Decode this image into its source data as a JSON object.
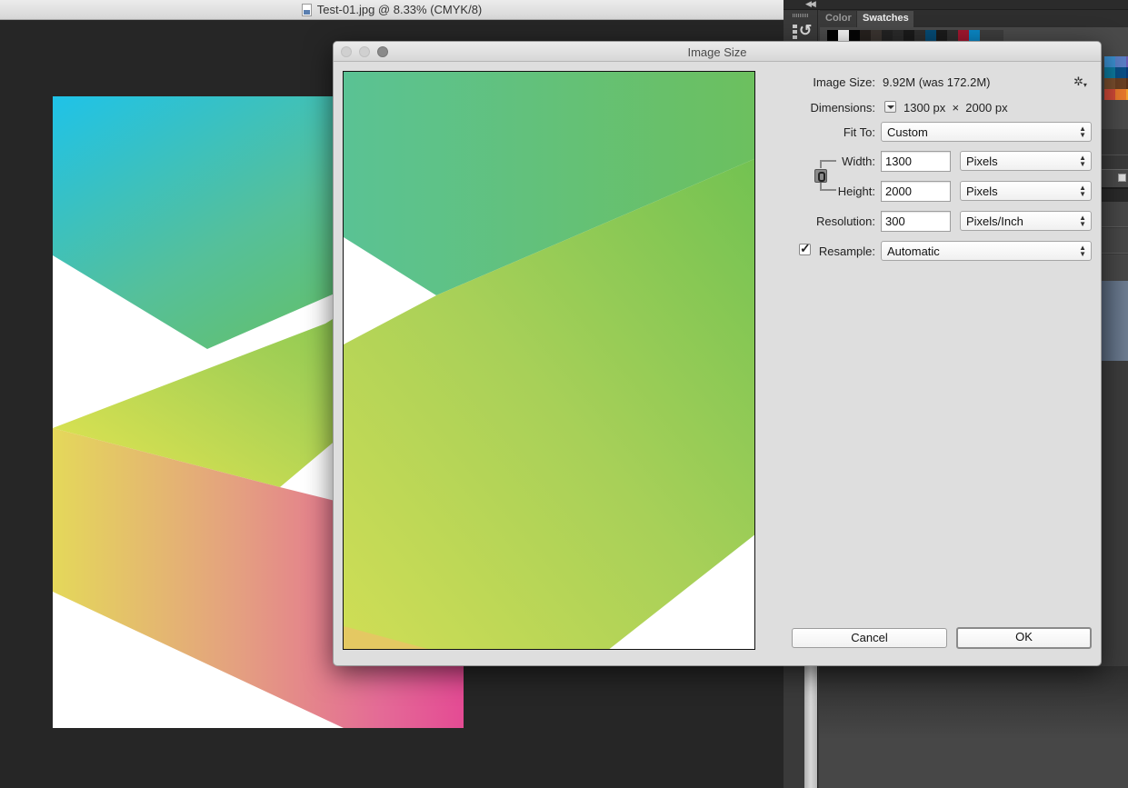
{
  "document": {
    "title": "Test-01.jpg @ 8.33% (CMYK/8)",
    "icon": "jpg-file-icon"
  },
  "panels": {
    "tabs": [
      {
        "label": "Color",
        "active": false
      },
      {
        "label": "Swatches",
        "active": true
      }
    ],
    "swatches_row": [
      "#000000",
      "#f4f4f4",
      "#050505",
      "#26211e",
      "#3a3430",
      "#222222",
      "#2a2a2a",
      "#1a1a1a",
      "#2e2e2e",
      "#054a73",
      "#1b1b1b",
      "#2f2f2f",
      "#a0162f",
      "#0a86c4"
    ],
    "swatches_grid": [
      [
        "#3a8fd0",
        "#5a7ec5",
        "#6a5bb0"
      ],
      [
        "#0d7a9e",
        "#0a4f86",
        "#0a3a78"
      ],
      [
        "#7a4e2e",
        "#6a3f22",
        "#5a3018"
      ],
      [
        "#d24a38",
        "#e8782c",
        "#f0a030"
      ]
    ]
  },
  "dialog": {
    "title": "Image Size",
    "window_controls": [
      "close",
      "minimize",
      "zoom"
    ],
    "image_size_label": "Image Size:",
    "image_size_value": "9.92M (was 172.2M)",
    "settings_icon": "gear-icon",
    "dimensions_label": "Dimensions:",
    "dimensions_value": "1300 px  ×  2000 px",
    "fit_to_label": "Fit To:",
    "fit_to_value": "Custom",
    "width_label": "Width:",
    "width_value": "1300",
    "width_unit": "Pixels",
    "height_label": "Height:",
    "height_value": "2000",
    "height_unit": "Pixels",
    "constrain_proportions": true,
    "resolution_label": "Resolution:",
    "resolution_value": "300",
    "resolution_unit": "Pixels/Inch",
    "resample_label": "Resample:",
    "resample_checked": true,
    "resample_value": "Automatic",
    "cancel_label": "Cancel",
    "ok_label": "OK"
  }
}
